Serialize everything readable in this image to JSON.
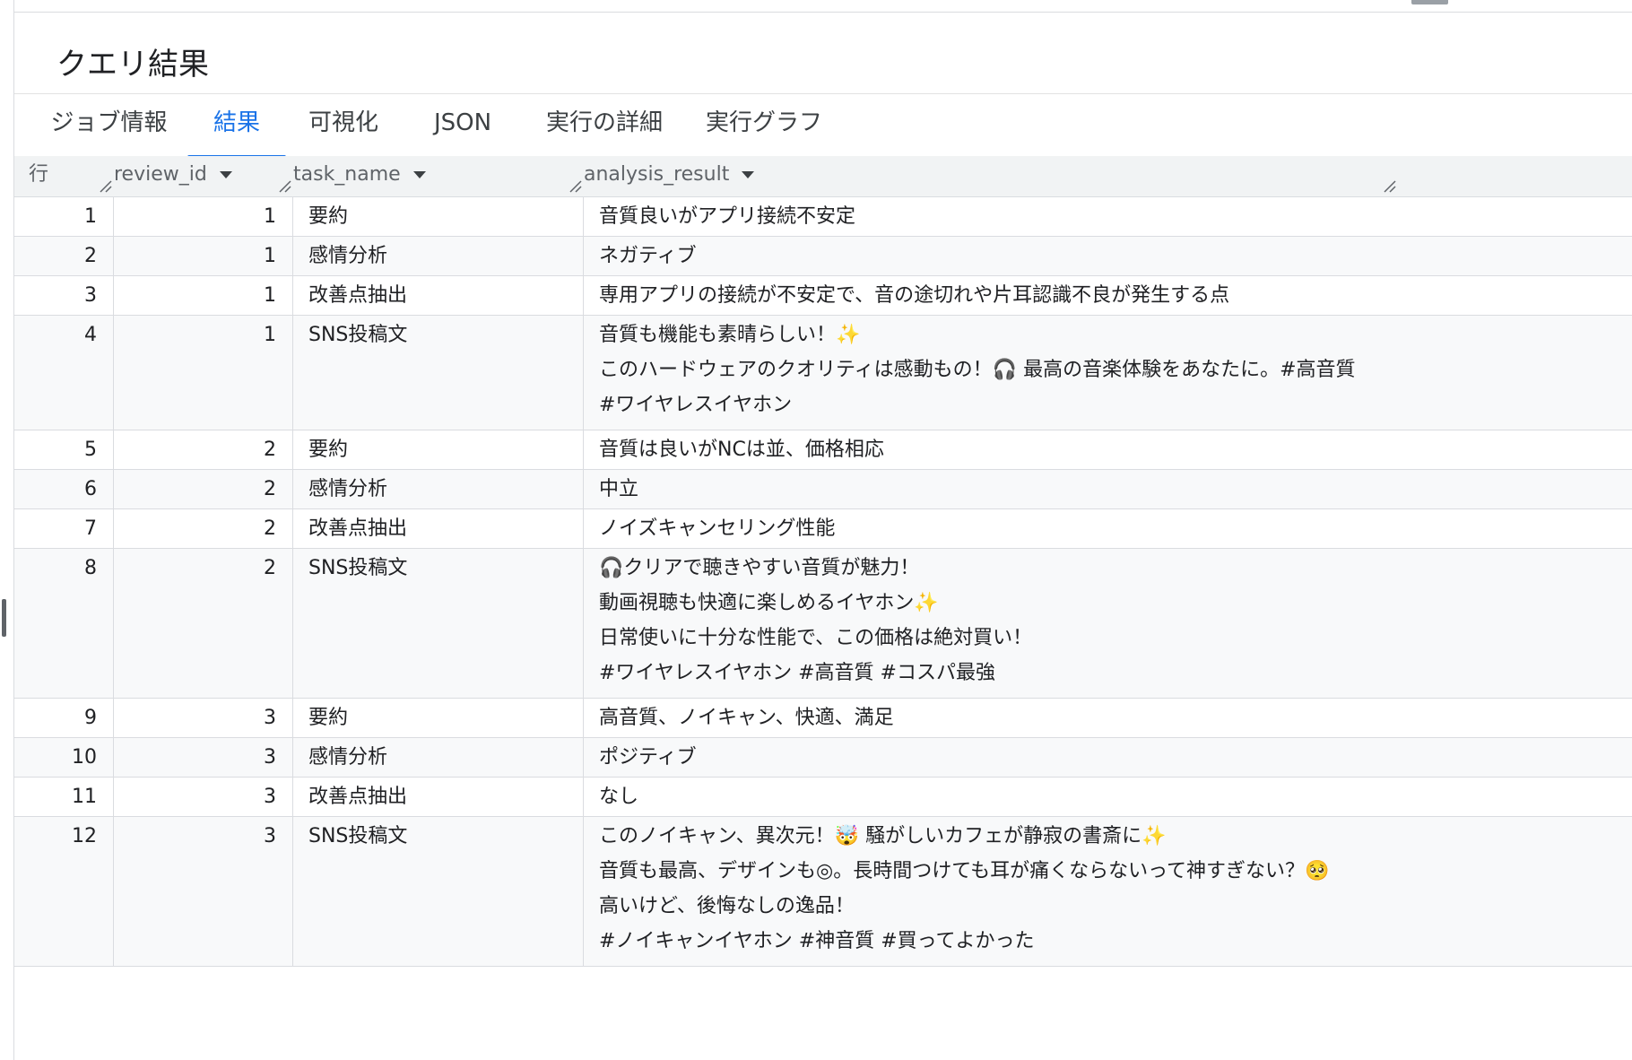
{
  "title": "クエリ結果",
  "tabs": [
    "ジョブ情報",
    "結果",
    "可視化",
    "JSON",
    "実行の詳細",
    "実行グラフ"
  ],
  "active_tab": "結果",
  "columns": {
    "row": "行",
    "review_id": "review_id",
    "task_name": "task_name",
    "analysis_result": "analysis_result"
  },
  "rows": [
    {
      "row": "1",
      "review_id": "1",
      "task_name": "要約",
      "lines": [
        "音質良いがアプリ接続不安定"
      ]
    },
    {
      "row": "2",
      "review_id": "1",
      "task_name": "感情分析",
      "lines": [
        "ネガティブ"
      ]
    },
    {
      "row": "3",
      "review_id": "1",
      "task_name": "改善点抽出",
      "lines": [
        "専用アプリの接続が不安定で、音の途切れや片耳認識不良が発生する点"
      ]
    },
    {
      "row": "4",
      "review_id": "1",
      "task_name": "SNS投稿文",
      "lines": [
        "音質も機能も素晴らしい！✨",
        "このハードウェアのクオリティは感動もの！🎧 最高の音楽体験をあなたに。#高音質",
        "#ワイヤレスイヤホン"
      ]
    },
    {
      "row": "5",
      "review_id": "2",
      "task_name": "要約",
      "lines": [
        "音質は良いがNCは並、価格相応"
      ]
    },
    {
      "row": "6",
      "review_id": "2",
      "task_name": "感情分析",
      "lines": [
        "中立"
      ]
    },
    {
      "row": "7",
      "review_id": "2",
      "task_name": "改善点抽出",
      "lines": [
        "ノイズキャンセリング性能"
      ]
    },
    {
      "row": "8",
      "review_id": "2",
      "task_name": "SNS投稿文",
      "lines": [
        "🎧クリアで聴きやすい音質が魅力！",
        "動画視聴も快適に楽しめるイヤホン✨",
        "日常使いに十分な性能で、この価格は絶対買い！",
        "#ワイヤレスイヤホン #高音質 #コスパ最強"
      ]
    },
    {
      "row": "9",
      "review_id": "3",
      "task_name": "要約",
      "lines": [
        "高音質、ノイキャン、快適、満足"
      ]
    },
    {
      "row": "10",
      "review_id": "3",
      "task_name": "感情分析",
      "lines": [
        "ポジティブ"
      ]
    },
    {
      "row": "11",
      "review_id": "3",
      "task_name": "改善点抽出",
      "lines": [
        "なし"
      ]
    },
    {
      "row": "12",
      "review_id": "3",
      "task_name": "SNS投稿文",
      "lines": [
        "このノイキャン、異次元！🤯 騒がしいカフェが静寂の書斎に✨",
        "音質も最高、デザインも◎。長時間つけても耳が痛くならないって神すぎない？🥺",
        "高いけど、後悔なしの逸品！",
        "#ノイキャンイヤホン #神音質 #買ってよかった"
      ]
    }
  ]
}
